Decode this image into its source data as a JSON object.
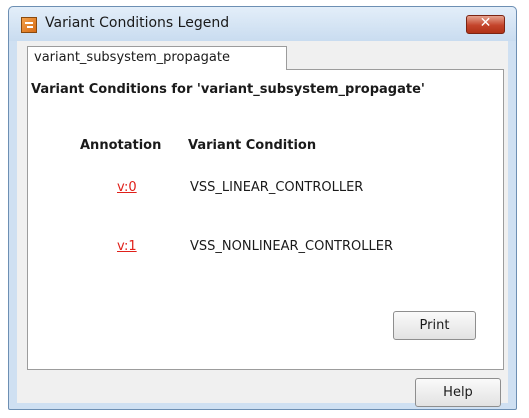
{
  "window": {
    "title": "Variant Conditions Legend",
    "close_glyph": "✕"
  },
  "tab": {
    "label": "variant_subsystem_propagate"
  },
  "panel": {
    "heading": "Variant Conditions for 'variant_subsystem_propagate'",
    "columns": {
      "annotation": "Annotation",
      "condition": "Variant Condition"
    },
    "rows": [
      {
        "annotation": "v:0",
        "condition": "VSS_LINEAR_CONTROLLER"
      },
      {
        "annotation": "v:1",
        "condition": "VSS_NONLINEAR_CONTROLLER"
      }
    ],
    "print_label": "Print"
  },
  "footer": {
    "help_label": "Help"
  },
  "icons": {
    "app": "simulink-app-icon",
    "close": "close-icon"
  },
  "colors": {
    "link": "#e0201a",
    "close_button": "#c4442b",
    "window_frame": "#cfe0f2"
  }
}
